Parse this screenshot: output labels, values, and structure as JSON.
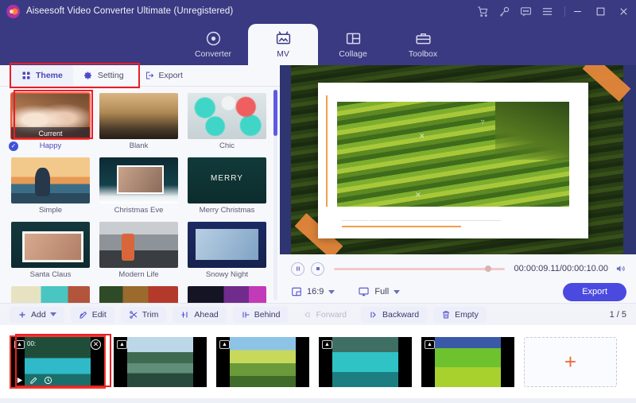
{
  "titlebar": {
    "app_title": "Aiseesoft Video Converter Ultimate (Unregistered)",
    "icons": [
      {
        "name": "cart-icon",
        "glyph": "\u0000"
      },
      {
        "name": "key-icon",
        "glyph": "\u0000"
      },
      {
        "name": "feedback-icon",
        "glyph": "\u0000"
      },
      {
        "name": "menu-icon",
        "glyph": "\u0000"
      }
    ],
    "minimize": "—",
    "maximize": "□",
    "close": "✕"
  },
  "nav": {
    "tabs": [
      {
        "label": "Converter",
        "icon": "converter-icon",
        "active": false
      },
      {
        "label": "MV",
        "icon": "mv-icon",
        "active": true
      },
      {
        "label": "Collage",
        "icon": "collage-icon",
        "active": false
      },
      {
        "label": "Toolbox",
        "icon": "toolbox-icon",
        "active": false
      }
    ]
  },
  "subtabs": [
    {
      "label": "Theme",
      "icon": "grid-icon",
      "active": true
    },
    {
      "label": "Setting",
      "icon": "gear-icon",
      "active": false
    },
    {
      "label": "Export",
      "icon": "export-icon",
      "active": false
    }
  ],
  "themes": {
    "current_badge": "Current",
    "check_glyph": "✓",
    "items": [
      {
        "name": "Happy",
        "art": "art-happy",
        "selected": true,
        "current": true
      },
      {
        "name": "Blank",
        "art": "art-blank",
        "selected": false,
        "current": false
      },
      {
        "name": "Chic",
        "art": "art-chic",
        "selected": false,
        "current": false
      },
      {
        "name": "Simple",
        "art": "art-simple",
        "selected": false,
        "current": false
      },
      {
        "name": "Christmas Eve",
        "art": "art-xmas-eve",
        "selected": false,
        "current": false
      },
      {
        "name": "Merry Christmas",
        "art": "art-merry",
        "selected": false,
        "current": false
      },
      {
        "name": "Santa Claus",
        "art": "art-santa",
        "selected": false,
        "current": false
      },
      {
        "name": "Modern Life",
        "art": "art-modern",
        "selected": false,
        "current": false
      },
      {
        "name": "Snowy Night",
        "art": "art-snowy",
        "selected": false,
        "current": false
      },
      {
        "name": "",
        "art": "art-r4a",
        "selected": false,
        "current": false
      },
      {
        "name": "",
        "art": "art-r4b",
        "selected": false,
        "current": false
      },
      {
        "name": "",
        "art": "art-r4c",
        "selected": false,
        "current": false
      }
    ]
  },
  "player": {
    "time_display": "00:00:09.11/00:00:10.00",
    "current_time": "00:00:09.11",
    "total_time": "00:00:10.00",
    "progress_percent": 91,
    "aspect_ratio": "16:9",
    "screen_mode": "Full",
    "export_label": "Export",
    "pause_icon": "pause-icon",
    "stop_icon": "stop-icon",
    "volume_icon": "volume-icon"
  },
  "toolbar": {
    "buttons": [
      {
        "label": "Add",
        "icon": "plus-icon",
        "dropdown": true,
        "disabled": false
      },
      {
        "label": "Edit",
        "icon": "edit-icon",
        "dropdown": false,
        "disabled": false
      },
      {
        "label": "Trim",
        "icon": "scissors-icon",
        "dropdown": false,
        "disabled": false
      },
      {
        "label": "Ahead",
        "icon": "insert-ahead-icon",
        "dropdown": false,
        "disabled": false
      },
      {
        "label": "Behind",
        "icon": "insert-behind-icon",
        "dropdown": false,
        "disabled": false
      },
      {
        "label": "Forward",
        "icon": "move-forward-icon",
        "dropdown": false,
        "disabled": true
      },
      {
        "label": "Backward",
        "icon": "move-backward-icon",
        "dropdown": false,
        "disabled": false
      },
      {
        "label": "Empty",
        "icon": "trash-icon",
        "dropdown": false,
        "disabled": false
      }
    ],
    "page_count": "1 / 5"
  },
  "timeline": {
    "clips": [
      {
        "art": "c1",
        "time": "00:",
        "selected": true,
        "badge": "image-badge"
      },
      {
        "art": "c2",
        "time": "",
        "selected": false,
        "badge": "image-badge"
      },
      {
        "art": "c3",
        "time": "",
        "selected": false,
        "badge": "image-badge"
      },
      {
        "art": "c4",
        "time": "",
        "selected": false,
        "badge": "image-badge"
      },
      {
        "art": "c5",
        "time": "",
        "selected": false,
        "badge": "image-badge"
      }
    ],
    "add_label": "+",
    "close_glyph": "✕"
  },
  "colors": {
    "header": "#3a3a82",
    "accent": "#4a4ae0",
    "annotation": "#ed1c24",
    "add_plus": "#ef6a3c",
    "selected_clip": "#ef3b2c"
  }
}
